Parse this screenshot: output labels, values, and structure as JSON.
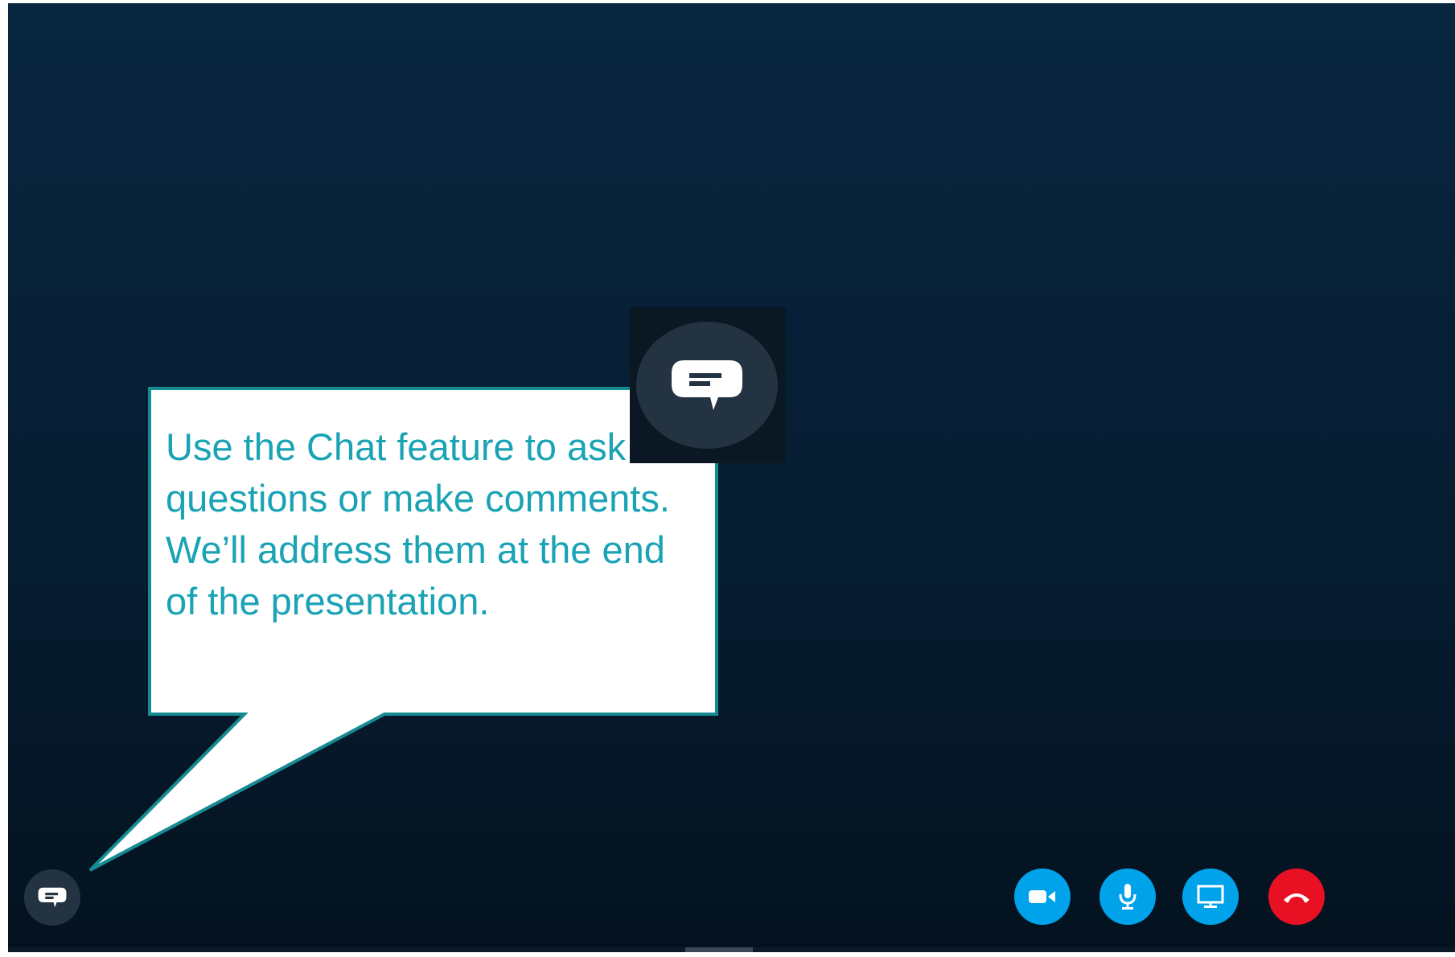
{
  "callout": {
    "text": "Use the Chat feature to ask questions or make comments. We’ll address them at the end of the presentation."
  },
  "colors": {
    "callout_border": "#168b93",
    "callout_text": "#1aa3b5",
    "callout_fill": "#ffffff",
    "control_blue": "#00a2ea",
    "hangup_red": "#e81123",
    "chat_button": "#243341"
  },
  "controls": {
    "chat": {
      "icon": "chat-bubble-icon"
    },
    "video": {
      "icon": "video-camera-icon"
    },
    "mic": {
      "icon": "microphone-icon"
    },
    "share": {
      "icon": "screen-share-icon"
    },
    "hangup": {
      "icon": "phone-hangup-icon"
    }
  },
  "zoom_inset": {
    "icon": "chat-bubble-icon"
  }
}
